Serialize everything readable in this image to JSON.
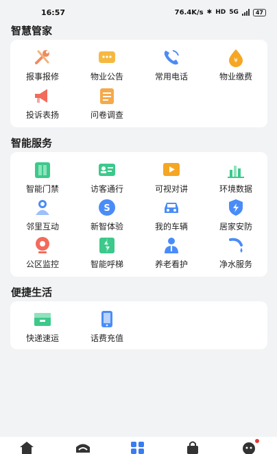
{
  "status_bar": {
    "time": "16:57",
    "speed": "76.4K/s",
    "network": "5G",
    "battery": "47"
  },
  "sections": [
    {
      "title": "智慧管家",
      "items": [
        {
          "label": "报事报修",
          "icon": "repair-tools-icon",
          "color": "#f08a5d"
        },
        {
          "label": "物业公告",
          "icon": "announcement-chat-icon",
          "color": "#f5b942"
        },
        {
          "label": "常用电话",
          "icon": "phone-icon",
          "color": "#4a8cf7"
        },
        {
          "label": "物业缴费",
          "icon": "payment-drop-icon",
          "color": "#f5a623"
        },
        {
          "label": "投诉表扬",
          "icon": "complaint-megaphone-icon",
          "color": "#f26b5b"
        },
        {
          "label": "问卷调查",
          "icon": "survey-document-icon",
          "color": "#f5a94a"
        }
      ]
    },
    {
      "title": "智能服务",
      "items": [
        {
          "label": "智能门禁",
          "icon": "door-access-icon",
          "color": "#3cc98b"
        },
        {
          "label": "访客通行",
          "icon": "visitor-card-icon",
          "color": "#3cc98b"
        },
        {
          "label": "可视对讲",
          "icon": "video-intercom-icon",
          "color": "#f5a623"
        },
        {
          "label": "环境数据",
          "icon": "environment-chart-icon",
          "color": "#3cc98b"
        },
        {
          "label": "邻里互动",
          "icon": "neighbor-interaction-icon",
          "color": "#4a8cf7"
        },
        {
          "label": "新智体验",
          "icon": "smart-experience-icon",
          "color": "#4a8cf7"
        },
        {
          "label": "我的车辆",
          "icon": "car-icon",
          "color": "#4a8cf7"
        },
        {
          "label": "居家安防",
          "icon": "home-security-shield-icon",
          "color": "#4a8cf7"
        },
        {
          "label": "公区监控",
          "icon": "surveillance-camera-icon",
          "color": "#f26b5b"
        },
        {
          "label": "智能呼梯",
          "icon": "elevator-call-icon",
          "color": "#3cc98b"
        },
        {
          "label": "养老看护",
          "icon": "elder-care-icon",
          "color": "#4a8cf7"
        },
        {
          "label": "净水服务",
          "icon": "water-purifier-icon",
          "color": "#4a8cf7"
        }
      ]
    },
    {
      "title": "便捷生活",
      "items": [
        {
          "label": "快递速运",
          "icon": "express-package-icon",
          "color": "#3cc98b"
        },
        {
          "label": "话费充值",
          "icon": "mobile-recharge-icon",
          "color": "#4a8cf7"
        }
      ]
    }
  ],
  "tabbar": [
    {
      "name": "home-tab",
      "icon": "home-icon"
    },
    {
      "name": "community-tab",
      "icon": "community-icon"
    },
    {
      "name": "services-tab",
      "icon": "grid-apps-icon",
      "active": true
    },
    {
      "name": "shop-tab",
      "icon": "shopping-bag-icon"
    },
    {
      "name": "profile-tab",
      "icon": "profile-face-icon",
      "badge": true
    }
  ]
}
